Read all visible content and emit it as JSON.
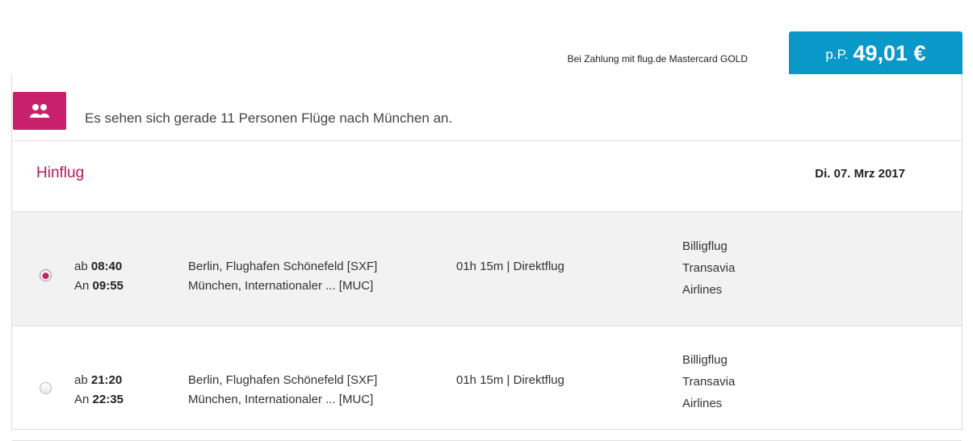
{
  "header": {
    "payment_info": "Bei Zahlung mit flug.de Mastercard GOLD",
    "price_prefix": "p.P.",
    "price": "49,01 €"
  },
  "notice": {
    "icon": "people-icon",
    "text": "Es sehen sich gerade 11 Personen Flüge nach München an."
  },
  "outbound": {
    "label": "Hinflug",
    "date": "Di. 07. Mrz 2017"
  },
  "flights": [
    {
      "selected": true,
      "dep_prefix": "ab",
      "dep_time": "08:40",
      "arr_prefix": "An",
      "arr_time": "09:55",
      "from": "Berlin, Flughafen Schönefeld [SXF]",
      "to": "München, Internationaler ... [MUC]",
      "duration": "01h 15m | Direktflug",
      "airline_type": "Billigflug",
      "airline_line1": "Transavia",
      "airline_line2": "Airlines"
    },
    {
      "selected": false,
      "dep_prefix": "ab",
      "dep_time": "21:20",
      "arr_prefix": "An",
      "arr_time": "22:35",
      "from": "Berlin, Flughafen Schönefeld [SXF]",
      "to": "München, Internationaler ... [MUC]",
      "duration": "01h 15m | Direktflug",
      "airline_type": "Billigflug",
      "airline_line1": "Transavia",
      "airline_line2": "Airlines"
    }
  ],
  "colors": {
    "accent_blue": "#0a98c9",
    "accent_magenta": "#c8206a",
    "heading_magenta": "#b4195e"
  }
}
